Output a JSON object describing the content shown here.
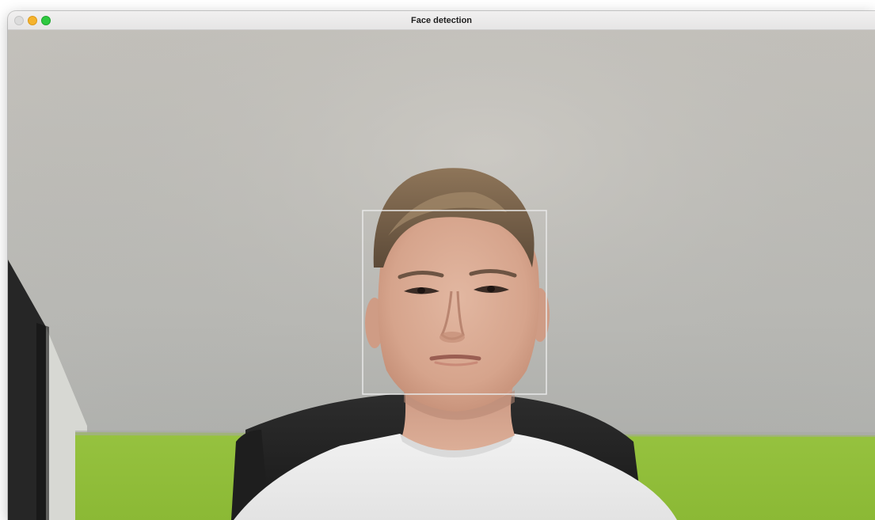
{
  "window": {
    "title": "Face detection",
    "controls": [
      {
        "name": "close",
        "color": "#d9d9d9"
      },
      {
        "name": "minimize",
        "color": "#f5b32d"
      },
      {
        "name": "zoom",
        "color": "#2ec940"
      }
    ]
  },
  "detection": {
    "box_color": "#e8e8e8"
  }
}
